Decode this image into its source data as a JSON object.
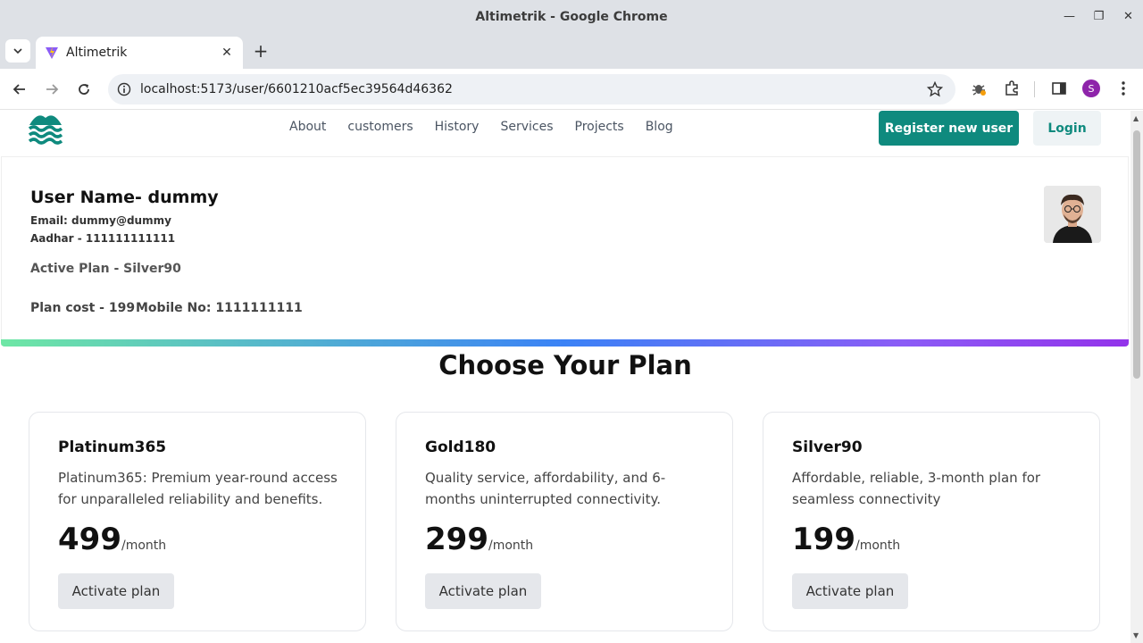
{
  "window": {
    "title": "Altimetrik - Google Chrome"
  },
  "tab": {
    "title": "Altimetrik"
  },
  "toolbar": {
    "url": "localhost:5173/user/6601210acf5ec39564d46362",
    "profile_initial": "S"
  },
  "nav": {
    "items": [
      "About",
      "customers",
      "History",
      "Services",
      "Projects",
      "Blog"
    ],
    "register_label": "Register new user",
    "login_label": "Login"
  },
  "user": {
    "name": "User Name- dummy",
    "email": "Email: dummy@dummy",
    "aadhar": "Aadhar - 111111111111",
    "active_plan": "Active Plan - Silver90",
    "plan_cost": "Plan cost - 199",
    "mobile": "Mobile No: 1111111111"
  },
  "plans_section": {
    "title": "Choose Your Plan",
    "plans": [
      {
        "name": "Platinum365",
        "description": "Platinum365: Premium year-round access for unparalleled reliability and benefits.",
        "price": "499",
        "unit": "/month",
        "button": "Activate plan"
      },
      {
        "name": "Gold180",
        "description": "Quality service, affordability, and 6-months uninterrupted connectivity.",
        "price": "299",
        "unit": "/month",
        "button": "Activate plan"
      },
      {
        "name": "Silver90",
        "description": "Affordable, reliable, 3-month plan for seamless connectivity",
        "price": "199",
        "unit": "/month",
        "button": "Activate plan"
      }
    ]
  },
  "colors": {
    "accent": "#0f8a7e",
    "profile": "#8e24aa"
  }
}
